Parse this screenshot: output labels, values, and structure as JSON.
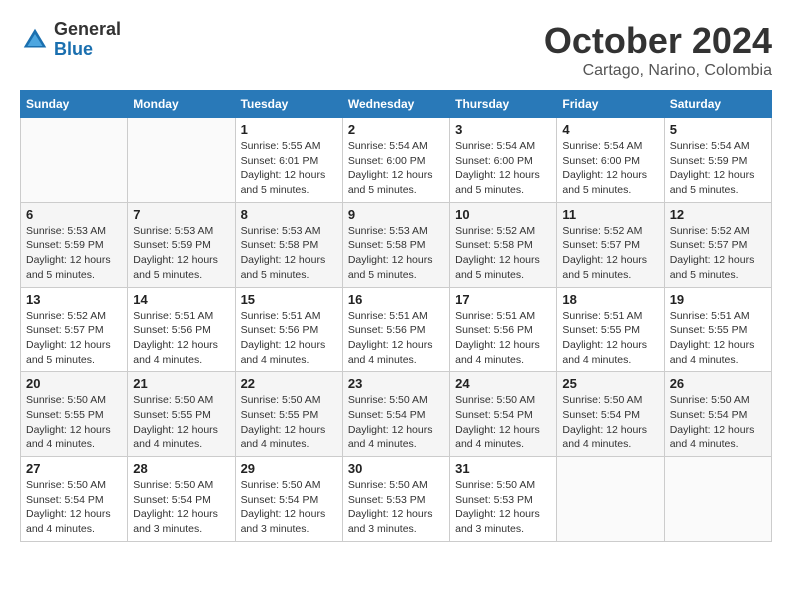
{
  "logo": {
    "general": "General",
    "blue": "Blue"
  },
  "title": "October 2024",
  "subtitle": "Cartago, Narino, Colombia",
  "weekdays": [
    "Sunday",
    "Monday",
    "Tuesday",
    "Wednesday",
    "Thursday",
    "Friday",
    "Saturday"
  ],
  "weeks": [
    [
      {
        "day": "",
        "info": ""
      },
      {
        "day": "",
        "info": ""
      },
      {
        "day": "1",
        "info": "Sunrise: 5:55 AM\nSunset: 6:01 PM\nDaylight: 12 hours and 5 minutes."
      },
      {
        "day": "2",
        "info": "Sunrise: 5:54 AM\nSunset: 6:00 PM\nDaylight: 12 hours and 5 minutes."
      },
      {
        "day": "3",
        "info": "Sunrise: 5:54 AM\nSunset: 6:00 PM\nDaylight: 12 hours and 5 minutes."
      },
      {
        "day": "4",
        "info": "Sunrise: 5:54 AM\nSunset: 6:00 PM\nDaylight: 12 hours and 5 minutes."
      },
      {
        "day": "5",
        "info": "Sunrise: 5:54 AM\nSunset: 5:59 PM\nDaylight: 12 hours and 5 minutes."
      }
    ],
    [
      {
        "day": "6",
        "info": "Sunrise: 5:53 AM\nSunset: 5:59 PM\nDaylight: 12 hours and 5 minutes."
      },
      {
        "day": "7",
        "info": "Sunrise: 5:53 AM\nSunset: 5:59 PM\nDaylight: 12 hours and 5 minutes."
      },
      {
        "day": "8",
        "info": "Sunrise: 5:53 AM\nSunset: 5:58 PM\nDaylight: 12 hours and 5 minutes."
      },
      {
        "day": "9",
        "info": "Sunrise: 5:53 AM\nSunset: 5:58 PM\nDaylight: 12 hours and 5 minutes."
      },
      {
        "day": "10",
        "info": "Sunrise: 5:52 AM\nSunset: 5:58 PM\nDaylight: 12 hours and 5 minutes."
      },
      {
        "day": "11",
        "info": "Sunrise: 5:52 AM\nSunset: 5:57 PM\nDaylight: 12 hours and 5 minutes."
      },
      {
        "day": "12",
        "info": "Sunrise: 5:52 AM\nSunset: 5:57 PM\nDaylight: 12 hours and 5 minutes."
      }
    ],
    [
      {
        "day": "13",
        "info": "Sunrise: 5:52 AM\nSunset: 5:57 PM\nDaylight: 12 hours and 5 minutes."
      },
      {
        "day": "14",
        "info": "Sunrise: 5:51 AM\nSunset: 5:56 PM\nDaylight: 12 hours and 4 minutes."
      },
      {
        "day": "15",
        "info": "Sunrise: 5:51 AM\nSunset: 5:56 PM\nDaylight: 12 hours and 4 minutes."
      },
      {
        "day": "16",
        "info": "Sunrise: 5:51 AM\nSunset: 5:56 PM\nDaylight: 12 hours and 4 minutes."
      },
      {
        "day": "17",
        "info": "Sunrise: 5:51 AM\nSunset: 5:56 PM\nDaylight: 12 hours and 4 minutes."
      },
      {
        "day": "18",
        "info": "Sunrise: 5:51 AM\nSunset: 5:55 PM\nDaylight: 12 hours and 4 minutes."
      },
      {
        "day": "19",
        "info": "Sunrise: 5:51 AM\nSunset: 5:55 PM\nDaylight: 12 hours and 4 minutes."
      }
    ],
    [
      {
        "day": "20",
        "info": "Sunrise: 5:50 AM\nSunset: 5:55 PM\nDaylight: 12 hours and 4 minutes."
      },
      {
        "day": "21",
        "info": "Sunrise: 5:50 AM\nSunset: 5:55 PM\nDaylight: 12 hours and 4 minutes."
      },
      {
        "day": "22",
        "info": "Sunrise: 5:50 AM\nSunset: 5:55 PM\nDaylight: 12 hours and 4 minutes."
      },
      {
        "day": "23",
        "info": "Sunrise: 5:50 AM\nSunset: 5:54 PM\nDaylight: 12 hours and 4 minutes."
      },
      {
        "day": "24",
        "info": "Sunrise: 5:50 AM\nSunset: 5:54 PM\nDaylight: 12 hours and 4 minutes."
      },
      {
        "day": "25",
        "info": "Sunrise: 5:50 AM\nSunset: 5:54 PM\nDaylight: 12 hours and 4 minutes."
      },
      {
        "day": "26",
        "info": "Sunrise: 5:50 AM\nSunset: 5:54 PM\nDaylight: 12 hours and 4 minutes."
      }
    ],
    [
      {
        "day": "27",
        "info": "Sunrise: 5:50 AM\nSunset: 5:54 PM\nDaylight: 12 hours and 4 minutes."
      },
      {
        "day": "28",
        "info": "Sunrise: 5:50 AM\nSunset: 5:54 PM\nDaylight: 12 hours and 3 minutes."
      },
      {
        "day": "29",
        "info": "Sunrise: 5:50 AM\nSunset: 5:54 PM\nDaylight: 12 hours and 3 minutes."
      },
      {
        "day": "30",
        "info": "Sunrise: 5:50 AM\nSunset: 5:53 PM\nDaylight: 12 hours and 3 minutes."
      },
      {
        "day": "31",
        "info": "Sunrise: 5:50 AM\nSunset: 5:53 PM\nDaylight: 12 hours and 3 minutes."
      },
      {
        "day": "",
        "info": ""
      },
      {
        "day": "",
        "info": ""
      }
    ]
  ]
}
